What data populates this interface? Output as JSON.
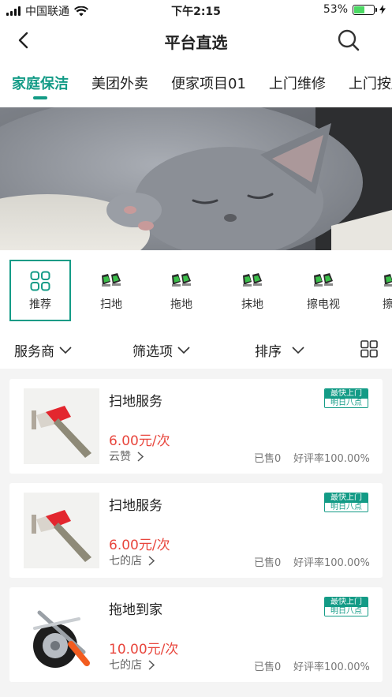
{
  "status_bar": {
    "carrier": "中国联通",
    "time": "下午2:15",
    "battery": "53%",
    "battery_level": 0.53
  },
  "nav": {
    "title": "平台直选"
  },
  "tabs": [
    {
      "label": "家庭保洁",
      "active": true
    },
    {
      "label": "美团外卖"
    },
    {
      "label": "便家项目01"
    },
    {
      "label": "上门维修"
    },
    {
      "label": "上门按摩"
    }
  ],
  "subcategories": [
    {
      "label": "推荐",
      "icon": "grid-icon"
    },
    {
      "label": "扫地",
      "icon": "shoes-icon"
    },
    {
      "label": "拖地",
      "icon": "shoes-icon"
    },
    {
      "label": "抹地",
      "icon": "shoes-icon"
    },
    {
      "label": "擦电视",
      "icon": "shoes-icon"
    },
    {
      "label": "擦椅",
      "icon": "shoes-icon"
    }
  ],
  "filters": {
    "provider": "服务商",
    "options": "筛选项",
    "sort": "排序"
  },
  "products": [
    {
      "title": "扫地服务",
      "price": "6.00元/次",
      "shop": "云赞",
      "sold": "已售0",
      "rating": "好评率100.00%",
      "badge_top": "最快上门",
      "badge_bottom": "明日八点",
      "image": "scraper"
    },
    {
      "title": "扫地服务",
      "price": "6.00元/次",
      "shop": "七的店",
      "sold": "已售0",
      "rating": "好评率100.00%",
      "badge_top": "最快上门",
      "badge_bottom": "明日八点",
      "image": "scraper"
    },
    {
      "title": "拖地到家",
      "price": "10.00元/次",
      "shop": "七的店",
      "sold": "已售0",
      "rating": "好评率100.00%",
      "badge_top": "最快上门",
      "badge_bottom": "明日八点",
      "image": "tire-tools"
    }
  ],
  "colors": {
    "accent": "#139b86",
    "price": "#e8463d"
  }
}
